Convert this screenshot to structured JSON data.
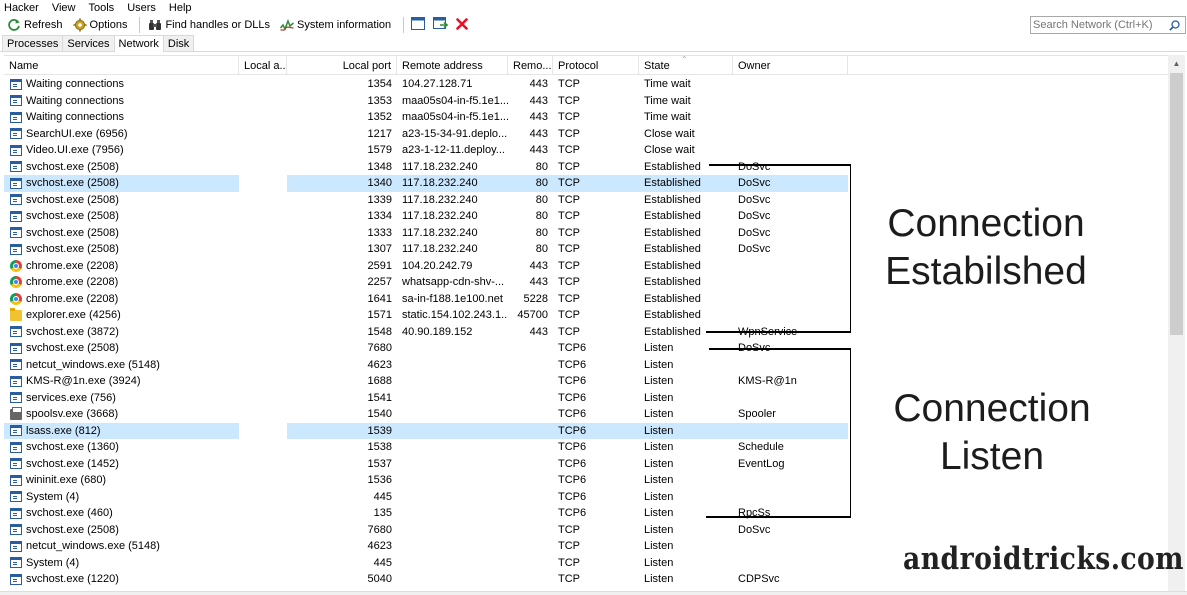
{
  "menu": [
    "Hacker",
    "View",
    "Tools",
    "Users",
    "Help"
  ],
  "toolbar": {
    "refresh": "Refresh",
    "options": "Options",
    "find_handles": "Find handles or DLLs",
    "system_information": "System information"
  },
  "search": {
    "placeholder": "Search Network (Ctrl+K)"
  },
  "tabs": [
    "Processes",
    "Services",
    "Network",
    "Disk"
  ],
  "active_tab": "Network",
  "columns": {
    "name": "Name",
    "local_address": "Local a...",
    "local_port": "Local port",
    "remote_address": "Remote address",
    "remote_port": "Remo...",
    "protocol": "Protocol",
    "state": "State",
    "owner": "Owner"
  },
  "rows": [
    {
      "icon": "window",
      "name": "Waiting connections",
      "local_address": "",
      "local_port": "1354",
      "remote_address": "104.27.128.71",
      "remote_port": "443",
      "protocol": "TCP",
      "state": "Time wait",
      "owner": ""
    },
    {
      "icon": "window",
      "name": "Waiting connections",
      "local_address": "",
      "local_port": "1353",
      "remote_address": "maa05s04-in-f5.1e1...",
      "remote_port": "443",
      "protocol": "TCP",
      "state": "Time wait",
      "owner": ""
    },
    {
      "icon": "window",
      "name": "Waiting connections",
      "local_address": "",
      "local_port": "1352",
      "remote_address": "maa05s04-in-f5.1e1...",
      "remote_port": "443",
      "protocol": "TCP",
      "state": "Time wait",
      "owner": ""
    },
    {
      "icon": "window",
      "name": "SearchUI.exe (6956)",
      "local_address": "",
      "local_port": "1217",
      "remote_address": "a23-15-34-91.deplo...",
      "remote_port": "443",
      "protocol": "TCP",
      "state": "Close wait",
      "owner": ""
    },
    {
      "icon": "window",
      "name": "Video.UI.exe (7956)",
      "local_address": "",
      "local_port": "1579",
      "remote_address": "a23-1-12-11.deploy...",
      "remote_port": "443",
      "protocol": "TCP",
      "state": "Close wait",
      "owner": ""
    },
    {
      "icon": "window",
      "name": "svchost.exe (2508)",
      "local_address": "",
      "local_port": "1348",
      "remote_address": "117.18.232.240",
      "remote_port": "80",
      "protocol": "TCP",
      "state": "Established",
      "owner": "DoSvc"
    },
    {
      "icon": "window",
      "name": "svchost.exe (2508)",
      "local_address": "",
      "local_port": "1340",
      "remote_address": "117.18.232.240",
      "remote_port": "80",
      "protocol": "TCP",
      "state": "Established",
      "owner": "DoSvc",
      "selected": true
    },
    {
      "icon": "window",
      "name": "svchost.exe (2508)",
      "local_address": "",
      "local_port": "1339",
      "remote_address": "117.18.232.240",
      "remote_port": "80",
      "protocol": "TCP",
      "state": "Established",
      "owner": "DoSvc"
    },
    {
      "icon": "window",
      "name": "svchost.exe (2508)",
      "local_address": "",
      "local_port": "1334",
      "remote_address": "117.18.232.240",
      "remote_port": "80",
      "protocol": "TCP",
      "state": "Established",
      "owner": "DoSvc"
    },
    {
      "icon": "window",
      "name": "svchost.exe (2508)",
      "local_address": "",
      "local_port": "1333",
      "remote_address": "117.18.232.240",
      "remote_port": "80",
      "protocol": "TCP",
      "state": "Established",
      "owner": "DoSvc"
    },
    {
      "icon": "window",
      "name": "svchost.exe (2508)",
      "local_address": "",
      "local_port": "1307",
      "remote_address": "117.18.232.240",
      "remote_port": "80",
      "protocol": "TCP",
      "state": "Established",
      "owner": "DoSvc"
    },
    {
      "icon": "chrome",
      "name": "chrome.exe (2208)",
      "local_address": "",
      "local_port": "2591",
      "remote_address": "104.20.242.79",
      "remote_port": "443",
      "protocol": "TCP",
      "state": "Established",
      "owner": ""
    },
    {
      "icon": "chrome",
      "name": "chrome.exe (2208)",
      "local_address": "",
      "local_port": "2257",
      "remote_address": "whatsapp-cdn-shv-...",
      "remote_port": "443",
      "protocol": "TCP",
      "state": "Established",
      "owner": ""
    },
    {
      "icon": "chrome",
      "name": "chrome.exe (2208)",
      "local_address": "",
      "local_port": "1641",
      "remote_address": "sa-in-f188.1e100.net",
      "remote_port": "5228",
      "protocol": "TCP",
      "state": "Established",
      "owner": ""
    },
    {
      "icon": "folder",
      "name": "explorer.exe (4256)",
      "local_address": "",
      "local_port": "1571",
      "remote_address": "static.154.102.243.1...",
      "remote_port": "45700",
      "protocol": "TCP",
      "state": "Established",
      "owner": ""
    },
    {
      "icon": "window",
      "name": "svchost.exe (3872)",
      "local_address": "",
      "local_port": "1548",
      "remote_address": "40.90.189.152",
      "remote_port": "443",
      "protocol": "TCP",
      "state": "Established",
      "owner": "WpnService"
    },
    {
      "icon": "window",
      "name": "svchost.exe (2508)",
      "local_address": "",
      "local_port": "7680",
      "remote_address": "",
      "remote_port": "",
      "protocol": "TCP6",
      "state": "Listen",
      "owner": "DoSvc"
    },
    {
      "icon": "window",
      "name": "netcut_windows.exe (5148)",
      "local_address": "",
      "local_port": "4623",
      "remote_address": "",
      "remote_port": "",
      "protocol": "TCP6",
      "state": "Listen",
      "owner": ""
    },
    {
      "icon": "window",
      "name": "KMS-R@1n.exe (3924)",
      "local_address": "",
      "local_port": "1688",
      "remote_address": "",
      "remote_port": "",
      "protocol": "TCP6",
      "state": "Listen",
      "owner": "KMS-R@1n"
    },
    {
      "icon": "window",
      "name": "services.exe (756)",
      "local_address": "",
      "local_port": "1541",
      "remote_address": "",
      "remote_port": "",
      "protocol": "TCP6",
      "state": "Listen",
      "owner": ""
    },
    {
      "icon": "printer",
      "name": "spoolsv.exe (3668)",
      "local_address": "",
      "local_port": "1540",
      "remote_address": "",
      "remote_port": "",
      "protocol": "TCP6",
      "state": "Listen",
      "owner": "Spooler"
    },
    {
      "icon": "window",
      "name": "lsass.exe (812)",
      "local_address": "",
      "local_port": "1539",
      "remote_address": "",
      "remote_port": "",
      "protocol": "TCP6",
      "state": "Listen",
      "owner": "",
      "selected": true
    },
    {
      "icon": "window",
      "name": "svchost.exe (1360)",
      "local_address": "",
      "local_port": "1538",
      "remote_address": "",
      "remote_port": "",
      "protocol": "TCP6",
      "state": "Listen",
      "owner": "Schedule"
    },
    {
      "icon": "window",
      "name": "svchost.exe (1452)",
      "local_address": "",
      "local_port": "1537",
      "remote_address": "",
      "remote_port": "",
      "protocol": "TCP6",
      "state": "Listen",
      "owner": "EventLog"
    },
    {
      "icon": "window",
      "name": "wininit.exe (680)",
      "local_address": "",
      "local_port": "1536",
      "remote_address": "",
      "remote_port": "",
      "protocol": "TCP6",
      "state": "Listen",
      "owner": ""
    },
    {
      "icon": "window",
      "name": "System (4)",
      "local_address": "",
      "local_port": "445",
      "remote_address": "",
      "remote_port": "",
      "protocol": "TCP6",
      "state": "Listen",
      "owner": ""
    },
    {
      "icon": "window",
      "name": "svchost.exe (460)",
      "local_address": "",
      "local_port": "135",
      "remote_address": "",
      "remote_port": "",
      "protocol": "TCP6",
      "state": "Listen",
      "owner": "RpcSs"
    },
    {
      "icon": "window",
      "name": "svchost.exe (2508)",
      "local_address": "",
      "local_port": "7680",
      "remote_address": "",
      "remote_port": "",
      "protocol": "TCP",
      "state": "Listen",
      "owner": "DoSvc"
    },
    {
      "icon": "window",
      "name": "netcut_windows.exe (5148)",
      "local_address": "",
      "local_port": "4623",
      "remote_address": "",
      "remote_port": "",
      "protocol": "TCP",
      "state": "Listen",
      "owner": ""
    },
    {
      "icon": "window",
      "name": "System (4)",
      "local_address": "",
      "local_port": "445",
      "remote_address": "",
      "remote_port": "",
      "protocol": "TCP",
      "state": "Listen",
      "owner": ""
    },
    {
      "icon": "window",
      "name": "svchost.exe (1220)",
      "local_address": "",
      "local_port": "5040",
      "remote_address": "",
      "remote_port": "",
      "protocol": "TCP",
      "state": "Listen",
      "owner": "CDPSvc"
    }
  ],
  "annotations": {
    "established": [
      "Connection",
      "Estabilshed"
    ],
    "listen": [
      "Connection",
      "Listen"
    ]
  },
  "watermark": "androidtricks.com",
  "colors": {
    "selection": "#cce8ff",
    "close_icon": "#e81123",
    "accent": "#2a5d9f"
  }
}
